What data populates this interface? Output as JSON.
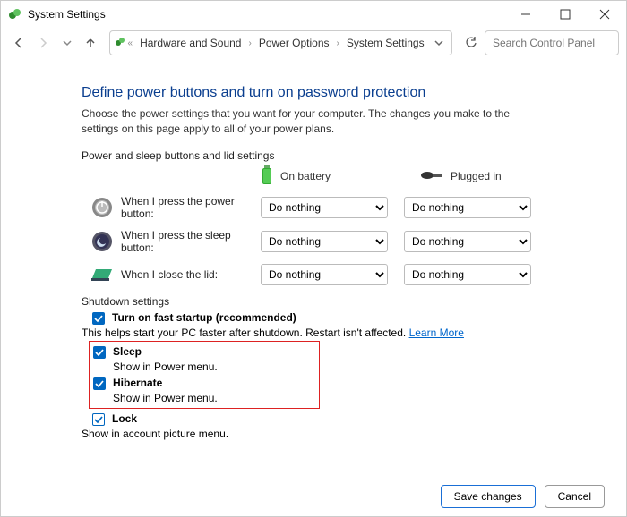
{
  "window": {
    "title": "System Settings",
    "search_placeholder": "Search Control Panel"
  },
  "breadcrumb": {
    "c1": "Hardware and Sound",
    "c2": "Power Options",
    "c3": "System Settings"
  },
  "heading": "Define power buttons and turn on password protection",
  "description": "Choose the power settings that you want for your computer. The changes you make to the settings on this page apply to all of your power plans.",
  "section1_label": "Power and sleep buttons and lid settings",
  "columns": {
    "battery": "On battery",
    "plugged": "Plugged in"
  },
  "rows": {
    "power": {
      "label": "When I press the power button:",
      "battery": "Do nothing",
      "plugged": "Do nothing"
    },
    "sleep": {
      "label": "When I press the sleep button:",
      "battery": "Do nothing",
      "plugged": "Do nothing"
    },
    "lid": {
      "label": "When I close the lid:",
      "battery": "Do nothing",
      "plugged": "Do nothing"
    }
  },
  "shutdown_label": "Shutdown settings",
  "options": {
    "faststartup": {
      "title": "Turn on fast startup (recommended)",
      "sub": "This helps start your PC faster after shutdown. Restart isn't affected. ",
      "learn": "Learn More"
    },
    "sleep": {
      "title": "Sleep",
      "sub": "Show in Power menu."
    },
    "hibernate": {
      "title": "Hibernate",
      "sub": "Show in Power menu."
    },
    "lock": {
      "title": "Lock",
      "sub": "Show in account picture menu."
    }
  },
  "buttons": {
    "save": "Save changes",
    "cancel": "Cancel"
  }
}
